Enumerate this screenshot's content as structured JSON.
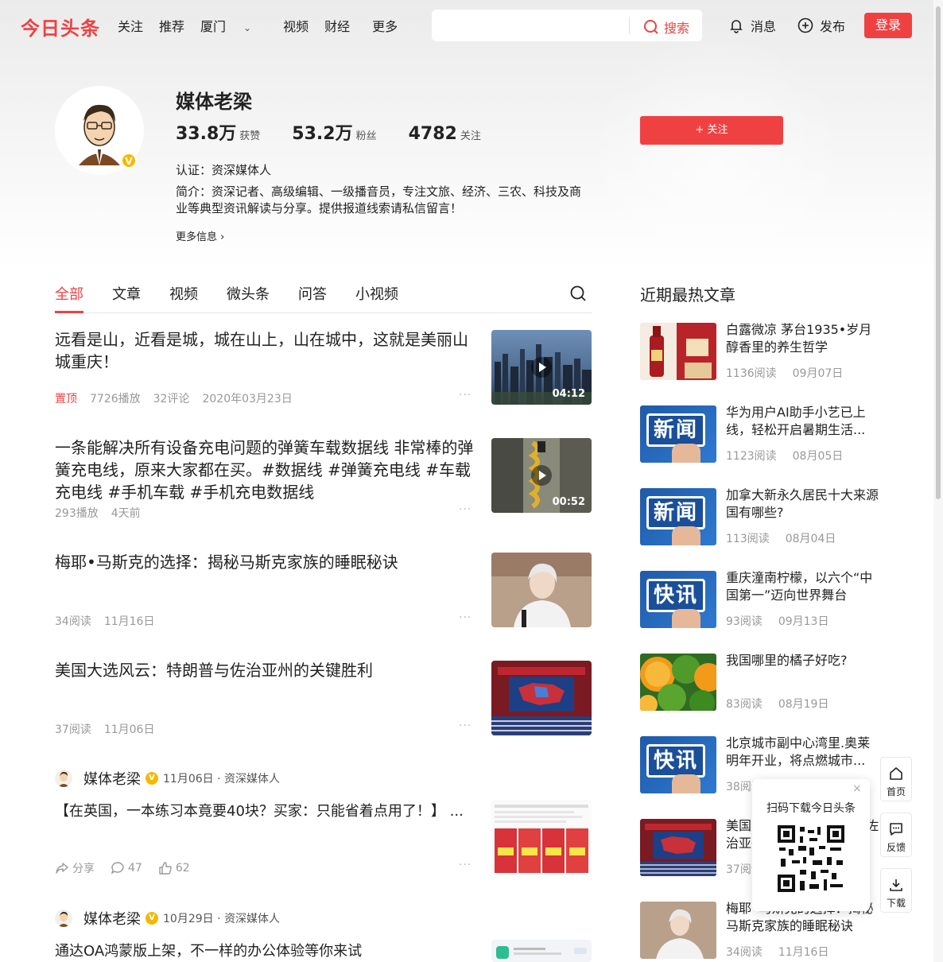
{
  "nav": {
    "logo": "今日头条",
    "links": [
      "关注",
      "推荐",
      "厦门",
      "视频",
      "财经",
      "更多"
    ],
    "search_button": "搜索",
    "search_placeholder": "",
    "messages": "消息",
    "publish": "发布",
    "login": "登录"
  },
  "profile": {
    "name": "媒体老梁",
    "likes_num": "33.8万",
    "likes_label": "获赞",
    "fans_num": "53.2万",
    "fans_label": "粉丝",
    "following_num": "4782",
    "following_label": "关注",
    "certification": "认证：资深媒体人",
    "intro": "简介：资深记者、高级编辑、一级播音员，专注文旅、经济、三农、科技及商业等典型资讯解读与分享。提供报道线索请私信留言！",
    "more_info": "更多信息",
    "follow_button": "+ 关注"
  },
  "tabs": [
    "全部",
    "文章",
    "视频",
    "微头条",
    "问答",
    "小视频"
  ],
  "feed": [
    {
      "title": "远看是山，近看是城，城在山上，山在城中，这就是美丽山城重庆！",
      "pin": "置顶",
      "plays": "7726播放",
      "comments": "32评论",
      "date": "2020年03月23日",
      "duration": "04:12"
    },
    {
      "title": "一条能解决所有设备充电问题的弹簧车载数据线 非常棒的弹簧充电线，原来大家都在买。#数据线 #弹簧充电线 #车载充电线 #手机车载 #手机充电数据线",
      "plays": "293播放",
      "date": "4天前",
      "duration": "00:52"
    },
    {
      "title": "梅耶•马斯克的选择：揭秘马斯克家族的睡眠秘诀",
      "reads": "34阅读",
      "date": "11月16日"
    },
    {
      "title": "美国大选风云：特朗普与佐治亚州的关键胜利",
      "reads": "37阅读",
      "date": "11月06日"
    }
  ],
  "posts": [
    {
      "author": "媒体老梁",
      "sub": "11月06日 · 资深媒体人",
      "text": "【在英国，一本练习本竟要40块？买家：只能省着点用了！】 ...",
      "share": "分享",
      "comments": "47",
      "likes": "62"
    },
    {
      "author": "媒体老梁",
      "sub": "10月29日 · 资深媒体人",
      "text": "通达OA鸿蒙版上架，不一样的办公体验等你来试"
    }
  ],
  "hot": {
    "title": "近期最热文章",
    "items": [
      {
        "title": "白露微凉 茅台1935•岁月醇香里的养生哲学",
        "reads": "1136阅读",
        "date": "09月07日"
      },
      {
        "title": "华为用户AI助手小艺已上线，轻松开启暑期生活...",
        "reads": "1123阅读",
        "date": "08月05日",
        "badge": "新闻"
      },
      {
        "title": "加拿大新永久居民十大来源国有哪些?",
        "reads": "113阅读",
        "date": "08月04日",
        "badge": "新闻"
      },
      {
        "title": "重庆潼南柠檬，以六个“中国第一”迈向世界舞台",
        "reads": "93阅读",
        "date": "09月13日",
        "badge": "快讯"
      },
      {
        "title": "我国哪里的橘子好吃?",
        "reads": "83阅读",
        "date": "08月19日"
      },
      {
        "title": "北京城市副中心湾里.奥莱明年开业，将点燃城市...",
        "reads": "38阅读",
        "date": "",
        "badge": "快讯"
      },
      {
        "title": "美国大选风云：特朗普与佐治亚州的关键胜利",
        "reads": "37阅读",
        "date": ""
      },
      {
        "title": "梅耶•马斯克的选择：揭秘马斯克家族的睡眠秘诀",
        "reads": "34阅读",
        "date": "11月16日"
      }
    ]
  },
  "floating": {
    "home": "首页",
    "feedback": "反馈",
    "download": "下载",
    "qr_title": "扫码下载今日头条",
    "close": "×"
  },
  "colors": {
    "brand": "#f04142",
    "verified": "#f5b800"
  }
}
